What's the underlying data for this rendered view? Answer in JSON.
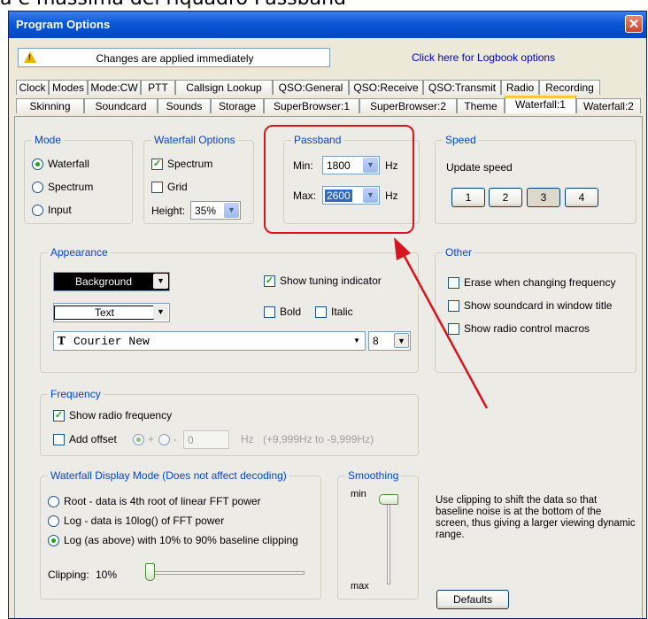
{
  "caption": "a e massima del riquadro Passband",
  "window": {
    "title": "Program Options",
    "close_glyph": "✕"
  },
  "info": {
    "message": "Changes are applied immediately",
    "logbook_link": "Click here for Logbook options"
  },
  "tabs_row1": [
    "Clock",
    "Modes",
    "Mode:CW",
    "PTT",
    "Callsign Lookup",
    "QSO:General",
    "QSO:Receive",
    "QSO:Transmit",
    "Radio",
    "Recording"
  ],
  "tabs_row2": [
    "Skinning",
    "Soundcard",
    "Sounds",
    "Storage",
    "SuperBrowser:1",
    "SuperBrowser:2",
    "Theme",
    "Waterfall:1",
    "Waterfall:2"
  ],
  "active_tab": "Waterfall:1",
  "mode": {
    "title": "Mode",
    "options": [
      "Waterfall",
      "Spectrum",
      "Input"
    ],
    "selected": "Waterfall"
  },
  "waterfall_options": {
    "title": "Waterfall Options",
    "spectrum_label": "Spectrum",
    "spectrum_checked": true,
    "grid_label": "Grid",
    "grid_checked": false,
    "height_label": "Height:",
    "height_value": "35%"
  },
  "passband": {
    "title": "Passband",
    "min_label": "Min:",
    "min_value": "1800",
    "max_label": "Max:",
    "max_value": "2600",
    "unit": "Hz"
  },
  "speed": {
    "title": "Speed",
    "label": "Update speed",
    "buttons": [
      "1",
      "2",
      "3",
      "4"
    ],
    "selected": "3"
  },
  "appearance": {
    "title": "Appearance",
    "background_label": "Background",
    "text_label": "Text",
    "show_tuning_label": "Show tuning indicator",
    "show_tuning_checked": true,
    "bold_label": "Bold",
    "italic_label": "Italic",
    "font_name": "Courier New",
    "font_size": "8",
    "font_icon": "T"
  },
  "other": {
    "title": "Other",
    "items": [
      "Erase when changing frequency",
      "Show soundcard in window title",
      "Show radio control macros"
    ]
  },
  "frequency": {
    "title": "Frequency",
    "show_radio_label": "Show radio frequency",
    "show_radio_checked": true,
    "add_offset_label": "Add offset",
    "plus": "+",
    "minus": "-",
    "offset_value": "0",
    "unit": "Hz",
    "range_hint": "(+9,999Hz to -9,999Hz)"
  },
  "display_mode": {
    "title": "Waterfall Display Mode (Does not affect decoding)",
    "options": [
      "Root - data is 4th root of linear FFT power",
      "Log - data is 10log() of FFT power",
      "Log (as above) with 10% to 90% baseline clipping"
    ],
    "selected_index": 2,
    "clipping_label": "Clipping:",
    "clipping_value": "10%"
  },
  "smoothing": {
    "title": "Smoothing",
    "min_label": "min",
    "max_label": "max"
  },
  "help_text": "Use clipping to shift the data so that baseline noise is at the bottom of the screen, thus giving a larger viewing dynamic range.",
  "defaults_button": "Defaults",
  "colors": {
    "title_bar": "#0a58d8",
    "group_title": "#0046d5",
    "annotation": "#d8141e"
  }
}
